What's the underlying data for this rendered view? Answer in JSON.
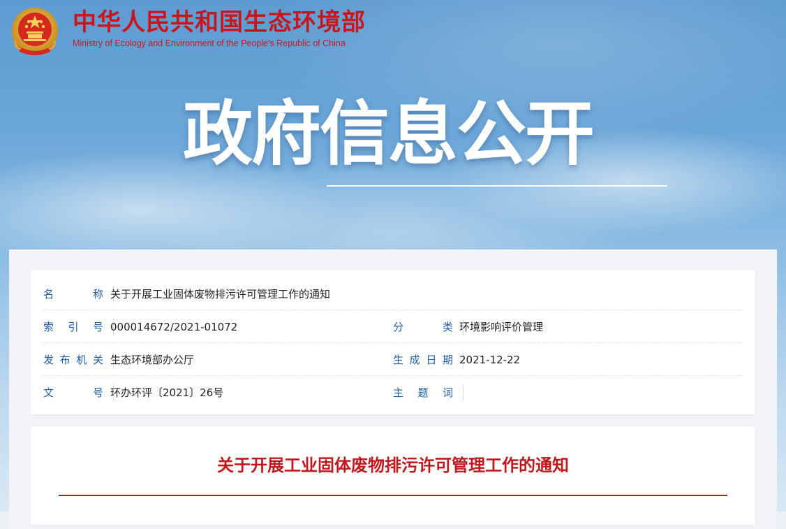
{
  "header": {
    "site_name_cn": "中华人民共和国生态环境部",
    "site_name_en": "Ministry of Ecology and Environment of the People's Republic of China",
    "emblem_icon": "national-emblem-icon",
    "banner_title": "政府信息公开"
  },
  "colors": {
    "brand_red": "#c8161d",
    "label_blue": "#1e5fa6",
    "title_red": "#c0181f"
  },
  "meta": {
    "rows": [
      {
        "label": "名　称",
        "value": "关于开展工业固体废物排污许可管理工作的通知"
      },
      {
        "label": "索 引 号",
        "value": "000014672/2021-01072",
        "label2": "分　类",
        "value2": "环境影响评价管理"
      },
      {
        "label": "发布机关",
        "value": "生态环境部办公厅",
        "label2": "生成日期",
        "value2": "2021-12-22"
      },
      {
        "label": "文　号",
        "value": "环办环评〔2021〕26号",
        "label2": "主 题 词",
        "value2": ""
      }
    ]
  },
  "document": {
    "title": "关于开展工业固体废物排污许可管理工作的通知"
  }
}
